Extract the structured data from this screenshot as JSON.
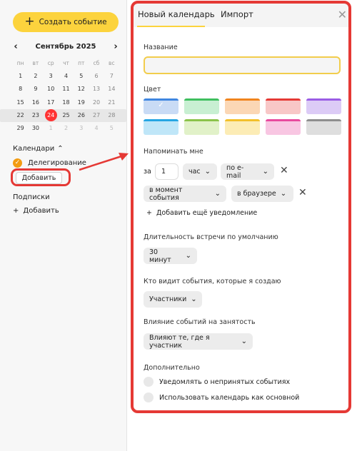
{
  "sidebar": {
    "create_label": "Создать событие",
    "month_title": "Сентябрь 2025",
    "prev_arrow": "‹",
    "next_arrow": "›",
    "dow": [
      "пн",
      "вт",
      "ср",
      "чт",
      "пт",
      "сб",
      "вс"
    ],
    "weeks": [
      [
        "1",
        "2",
        "3",
        "4",
        "5",
        "6",
        "7"
      ],
      [
        "8",
        "9",
        "10",
        "11",
        "12",
        "13",
        "14"
      ],
      [
        "15",
        "16",
        "17",
        "18",
        "19",
        "20",
        "21"
      ],
      [
        "22",
        "23",
        "24",
        "25",
        "26",
        "27",
        "28"
      ],
      [
        "29",
        "30",
        "1",
        "2",
        "3",
        "4",
        "5"
      ]
    ],
    "calendars_title": "Календари",
    "calendar_item": "Делегирование",
    "add_label": "Добавить",
    "subscriptions_title": "Подписки",
    "subscriptions_add": "Добавить"
  },
  "panel": {
    "tab_new": "Новый календарь",
    "tab_import": "Импорт",
    "name_label": "Название",
    "name_value": "",
    "color_label": "Цвет",
    "colors": [
      {
        "bar": "#3f86e0",
        "bg": "#c9dbf5"
      },
      {
        "bar": "#3fbf5f",
        "bg": "#c8efd2"
      },
      {
        "bar": "#f0841e",
        "bg": "#fbd7b5"
      },
      {
        "bar": "#e53935",
        "bg": "#f8c7c7"
      },
      {
        "bar": "#9a5de5",
        "bg": "#dccbf6"
      },
      {
        "bar": "#26a6e3",
        "bg": "#bfe6f8"
      },
      {
        "bar": "#8bc34a",
        "bg": "#e1f1c8"
      },
      {
        "bar": "#f3c02b",
        "bg": "#fcecb5"
      },
      {
        "bar": "#e84a9e",
        "bg": "#f8c6e2"
      },
      {
        "bar": "#8e8e8e",
        "bg": "#dedede"
      }
    ],
    "remind_label": "Напоминать мне",
    "za": "за",
    "remind_num": "1",
    "unit": "час",
    "channel1": "по e-mail",
    "when": "в момент события",
    "channel2": "в браузере",
    "add_reminder": "Добавить ещё уведомление",
    "duration_label": "Длительность встречи по умолчанию",
    "duration_value": "30 минут",
    "visibility_label": "Кто видит события, которые я создаю",
    "visibility_value": "Участники",
    "busy_label": "Влияние событий на занятость",
    "busy_value": "Влияют те, где я участник",
    "extra_label": "Дополнительно",
    "opt1": "Уведомлять о непринятых событиях",
    "opt2": "Использовать календарь как основной"
  },
  "accent": {
    "yellow": "#fcd33d",
    "red": "#e53935",
    "today": "#ff3333"
  }
}
